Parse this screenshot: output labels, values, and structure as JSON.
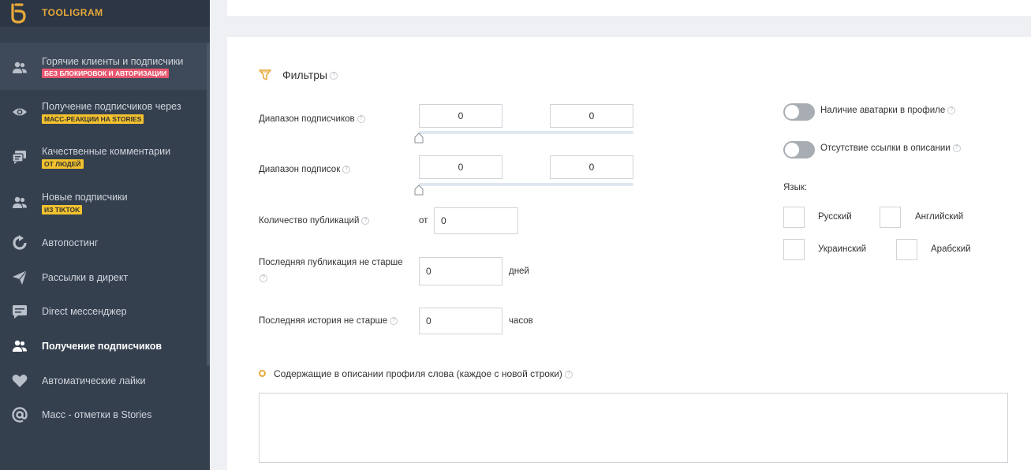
{
  "brand": {
    "name": "TOOLIGRAM",
    "color": "#e8a93a"
  },
  "sidebar": {
    "items": [
      {
        "label": "Горячие клиенты и подписчики",
        "badge": "БЕЗ БЛОКИРОВОК И АВТОРИЗАЦИИ",
        "badge_color": "#e8566e",
        "icon": "users-icon"
      },
      {
        "label": "Получение подписчиков через",
        "badge": "МАСС-РЕАКЦИИ НА STORIES",
        "badge_color": "#f2c12e",
        "icon": "eye-icon"
      },
      {
        "label": "Качественные комментарии",
        "badge": "ОТ ЛЮДЕЙ",
        "badge_color": "#f2c12e",
        "icon": "comment-icon"
      },
      {
        "label": "Новые подписчики",
        "badge": "ИЗ TIKTOK",
        "badge_color": "#f2c12e",
        "icon": "users-icon"
      },
      {
        "label": "Автопостинг",
        "icon": "refresh-icon"
      },
      {
        "label": "Рассылки в директ",
        "icon": "paper-plane-icon"
      },
      {
        "label": "Direct мессенджер",
        "icon": "message-icon"
      },
      {
        "label": "Получение подписчиков",
        "icon": "users-icon",
        "active": true
      },
      {
        "label": "Автоматические лайки",
        "icon": "heart-icon"
      },
      {
        "label": "Масс - отметки в Stories",
        "icon": "at-icon"
      }
    ]
  },
  "filters": {
    "title": "Фильтры",
    "followers_range": {
      "label": "Диапазон подписчиков",
      "min": "0",
      "max": "0"
    },
    "following_range": {
      "label": "Диапазон подписок",
      "min": "0",
      "max": "0"
    },
    "posts_count": {
      "label": "Количество публикаций",
      "prefix": "от",
      "value": "0"
    },
    "last_post": {
      "label": "Последняя публикация не старше",
      "value": "0",
      "unit": "дней"
    },
    "last_story": {
      "label": "Последняя история не старше",
      "value": "0",
      "unit": "часов"
    },
    "has_avatar": {
      "label": "Наличие аватарки в профиле",
      "enabled": false
    },
    "no_link": {
      "label": "Отсутствие ссылки в описании",
      "enabled": false
    },
    "language": {
      "label": "Язык:",
      "options": [
        "Русский",
        "Английский",
        "Украинский",
        "Арабский"
      ]
    },
    "bio_words": {
      "label": "Содержащие в описании профиля слова (каждое с новой строки)",
      "value": ""
    }
  },
  "colors": {
    "sidebar_bg": "#35404f",
    "accent": "#e8a93a",
    "badge_red": "#e8566e",
    "badge_yellow": "#f2c12e",
    "toggle_off": "#a8adb3"
  }
}
